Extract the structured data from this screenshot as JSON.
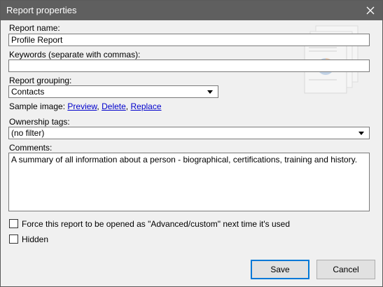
{
  "window": {
    "title": "Report properties",
    "close_icon": "close-icon"
  },
  "form": {
    "report_name_label": "Report name:",
    "report_name_value": "Profile Report",
    "keywords_label": "Keywords (separate with commas):",
    "keywords_value": "",
    "grouping_label": "Report grouping:",
    "grouping_value": "Contacts",
    "sample_label": "Sample image:",
    "sample_links": [
      "Preview",
      "Delete",
      "Replace"
    ],
    "sample_sep": ",",
    "ownership_label": "Ownership tags:",
    "ownership_value": "(no filter)",
    "comments_label": "Comments:",
    "comments_value": "A summary of all information about a person - biographical, certifications, training and history.",
    "force_advanced_label": "Force this report to be opened as \"Advanced/custom\" next time it's used",
    "force_advanced_checked": false,
    "hidden_label": "Hidden",
    "hidden_checked": false
  },
  "buttons": {
    "save": "Save",
    "cancel": "Cancel"
  },
  "colors": {
    "titlebar": "#5f5f5f",
    "link": "#0000cc",
    "default_button_border": "#0078d7"
  }
}
